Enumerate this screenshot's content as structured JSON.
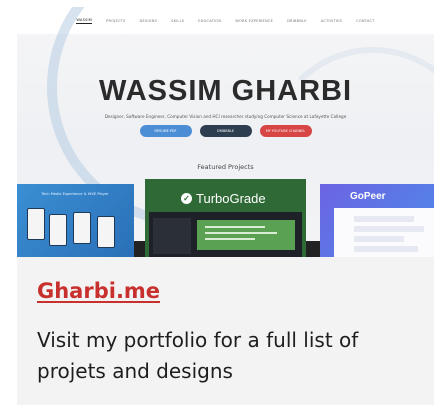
{
  "screenshot": {
    "nav": [
      "WASSIM",
      "PROJECTS",
      "DESIGNS",
      "SKILLS",
      "EDUCATION",
      "WORK EXPERIENCE",
      "DRIBBBLE",
      "ACTIVITIES",
      "CONTACT"
    ],
    "hero_name": "WASSIM GHARBI",
    "hero_subtitle": "Designer, Software Engineer, Computer Vision and HCI researcher studying Computer Science at Lafayette College",
    "hero_buttons": [
      "RESUME.PDF",
      "DRIBBBLE",
      "MY YOUTUBE CHANNEL"
    ],
    "featured_label": "Featured Projects",
    "project_1_title": "Tech Media Experience & HIVE Player",
    "project_2_logo": "TurboGrade",
    "project_3_logo": "GoPeer"
  },
  "card": {
    "title": "Gharbi.me",
    "description": "Visit my portfolio for a full list of projets and designs"
  },
  "colors": {
    "title": "#c8302e",
    "card_bg": "#f4f3f3",
    "turbograde_green": "#2f6a36"
  },
  "icons": {
    "check": "check-circle-icon"
  }
}
